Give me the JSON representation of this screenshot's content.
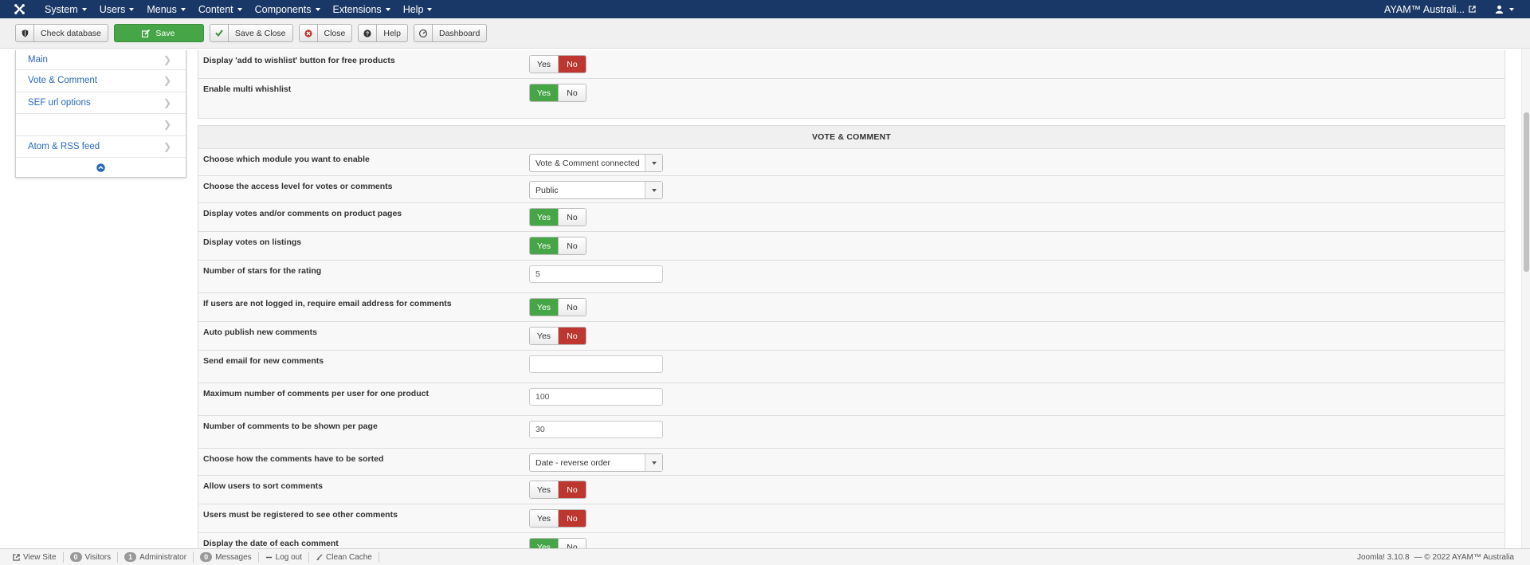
{
  "navbar": {
    "menus": [
      {
        "label": "System"
      },
      {
        "label": "Users"
      },
      {
        "label": "Menus"
      },
      {
        "label": "Content"
      },
      {
        "label": "Components"
      },
      {
        "label": "Extensions"
      },
      {
        "label": "Help"
      }
    ],
    "site_name": "AYAM™ Australi...",
    "bg_color": "#1a3867"
  },
  "toolbar": {
    "check_database": "Check database",
    "save": "Save",
    "save_close": "Save & Close",
    "close": "Close",
    "help": "Help",
    "dashboard": "Dashboard"
  },
  "sidebar": {
    "items": [
      {
        "label": "Main"
      },
      {
        "label": "Vote & Comment"
      },
      {
        "label": "SEF url options"
      },
      {
        "label": ""
      },
      {
        "label": "Atom & RSS feed"
      }
    ]
  },
  "top_panel": {
    "rows": [
      {
        "label": "Display 'add to wishlist' button for free products",
        "yes": "Yes",
        "no": "No",
        "value": "no"
      },
      {
        "label": "Enable multi whishlist",
        "yes": "Yes",
        "no": "No",
        "value": "yes"
      }
    ]
  },
  "vote_section": {
    "title": "VOTE & COMMENT",
    "rows": [
      {
        "label": "Choose which module you want to enable",
        "type": "select",
        "value": "Vote & Comment connected"
      },
      {
        "label": "Choose the access level for votes or comments",
        "type": "select",
        "value": "Public"
      },
      {
        "label": "Display votes and/or comments on product pages",
        "type": "yesno",
        "yes": "Yes",
        "no": "No",
        "value": "yes"
      },
      {
        "label": "Display votes on listings",
        "type": "yesno",
        "yes": "Yes",
        "no": "No",
        "value": "yes"
      },
      {
        "label": "Number of stars for the rating",
        "type": "input",
        "value": "5"
      },
      {
        "label": "If users are not logged in, require email address for comments",
        "type": "yesno",
        "yes": "Yes",
        "no": "No",
        "value": "yes"
      },
      {
        "label": "Auto publish new comments",
        "type": "yesno",
        "yes": "Yes",
        "no": "No",
        "value": "no"
      },
      {
        "label": "Send email for new comments",
        "type": "input",
        "value": ""
      },
      {
        "label": "Maximum number of comments per user for one product",
        "type": "input",
        "value": "100"
      },
      {
        "label": "Number of comments to be shown per page",
        "type": "input",
        "value": "30"
      },
      {
        "label": "Choose how the comments have to be sorted",
        "type": "select",
        "value": "Date - reverse order"
      },
      {
        "label": "Allow users to sort comments",
        "type": "yesno",
        "yes": "Yes",
        "no": "No",
        "value": "no"
      },
      {
        "label": "Users must be registered to see other comments",
        "type": "yesno",
        "yes": "Yes",
        "no": "No",
        "value": "no"
      },
      {
        "label": "Display the date of each comment",
        "type": "yesno",
        "yes": "Yes",
        "no": "No",
        "value": "yes"
      }
    ]
  },
  "statusbar": {
    "view_site": "View Site",
    "visitors_count": "0",
    "visitors": "Visitors",
    "admin_count": "1",
    "administrator": "Administrator",
    "messages_count": "0",
    "messages": "Messages",
    "logout": "Log out",
    "clean_cache": "Clean Cache",
    "version": "Joomla! 3.10.8",
    "copyright": "— © 2022 AYAM™ Australia"
  },
  "colors": {
    "yes_green": "#46a546",
    "no_red": "#bd362f",
    "link_blue": "#2a69b8"
  }
}
